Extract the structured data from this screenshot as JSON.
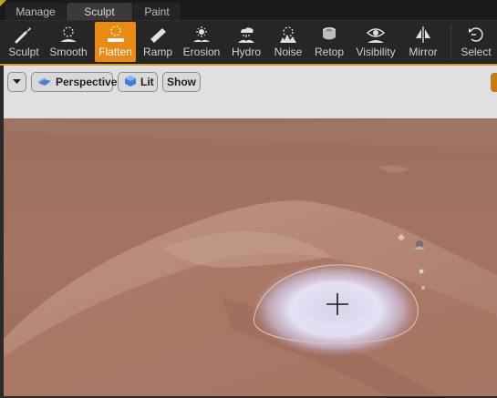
{
  "mode_tabs": [
    {
      "label": "Manage"
    },
    {
      "label": "Sculpt"
    },
    {
      "label": "Paint"
    }
  ],
  "tools": [
    {
      "label": "Sculpt",
      "icon": "sculpt-brush-icon"
    },
    {
      "label": "Smooth",
      "icon": "smooth-icon"
    },
    {
      "label": "Flatten",
      "icon": "flatten-icon",
      "active": true
    },
    {
      "label": "Ramp",
      "icon": "ramp-icon"
    },
    {
      "label": "Erosion",
      "icon": "erosion-icon"
    },
    {
      "label": "Hydro",
      "icon": "hydro-erosion-icon"
    },
    {
      "label": "Noise",
      "icon": "noise-icon"
    },
    {
      "label": "Retop",
      "icon": "retopologize-icon"
    },
    {
      "label": "Visibility",
      "icon": "visibility-icon"
    },
    {
      "label": "Mirror",
      "icon": "mirror-icon"
    },
    {
      "label": "Select",
      "icon": "select-icon"
    }
  ],
  "viewport": {
    "perspective_label": "Perspective",
    "lit_label": "Lit",
    "show_label": "Show"
  },
  "colors": {
    "accent": "#e98a12",
    "terrain": "#a57462",
    "brush": "#e7e2f4"
  }
}
